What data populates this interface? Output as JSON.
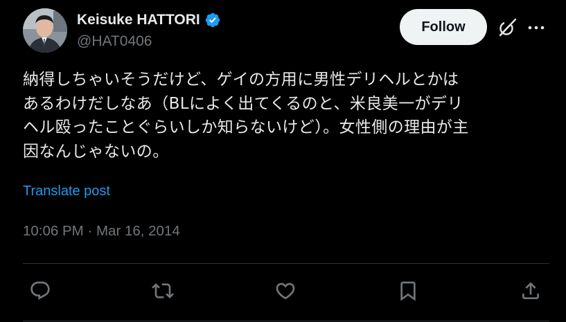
{
  "author": {
    "display_name": "Keisuke HATTORI",
    "handle": "@HAT0406",
    "verified": true,
    "avatar_icon": "avatar-photo"
  },
  "header": {
    "follow_label": "Follow",
    "grok_icon": "grok-icon",
    "more_icon": "more-icon"
  },
  "post": {
    "lines": [
      "納得しちゃいそうだけど、ゲイの方用に男性デリヘルとかは",
      "あるわけだしなあ（BLによく出てくるのと、米良美一がデリ",
      "ヘル殴ったことぐらいしか知らないけど）。女性側の理由が主",
      "因なんじゃないの。"
    ],
    "translate_label": "Translate post",
    "timestamp": "10:06 PM · Mar 16, 2014"
  },
  "actions": [
    {
      "name": "reply",
      "icon": "reply-icon"
    },
    {
      "name": "repost",
      "icon": "repost-icon"
    },
    {
      "name": "like",
      "icon": "like-icon"
    },
    {
      "name": "bookmark",
      "icon": "bookmark-icon"
    },
    {
      "name": "share",
      "icon": "share-icon"
    }
  ],
  "colors": {
    "background": "#000000",
    "text": "#e7e9ea",
    "secondary_text": "#71767b",
    "link": "#1d9bf0",
    "verified": "#1d9bf0",
    "divider": "#2f3336"
  }
}
